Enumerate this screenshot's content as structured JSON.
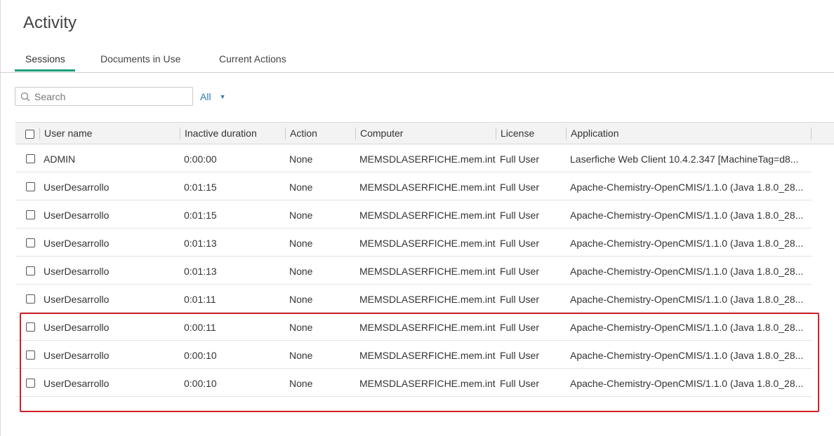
{
  "page": {
    "title": "Activity"
  },
  "tabs": [
    {
      "label": "Sessions",
      "active": true
    },
    {
      "label": "Documents in Use",
      "active": false
    },
    {
      "label": "Current Actions",
      "active": false
    }
  ],
  "search": {
    "placeholder": "Search",
    "value": ""
  },
  "filter": {
    "label": "All"
  },
  "grid": {
    "columns": [
      "User name",
      "Inactive duration",
      "Action",
      "Computer",
      "License",
      "Application"
    ],
    "rows": [
      {
        "user": "ADMIN",
        "inactive": "0:00:00",
        "action": "None",
        "computer": "MEMSDLASERFICHE.mem.int",
        "license": "Full User",
        "application": "Laserfiche Web Client 10.4.2.347 [MachineTag=d8..."
      },
      {
        "user": "UserDesarrollo",
        "inactive": "0:01:15",
        "action": "None",
        "computer": "MEMSDLASERFICHE.mem.int",
        "license": "Full User",
        "application": "Apache-Chemistry-OpenCMIS/1.1.0 (Java 1.8.0_28..."
      },
      {
        "user": "UserDesarrollo",
        "inactive": "0:01:15",
        "action": "None",
        "computer": "MEMSDLASERFICHE.mem.int",
        "license": "Full User",
        "application": "Apache-Chemistry-OpenCMIS/1.1.0 (Java 1.8.0_28..."
      },
      {
        "user": "UserDesarrollo",
        "inactive": "0:01:13",
        "action": "None",
        "computer": "MEMSDLASERFICHE.mem.int",
        "license": "Full User",
        "application": "Apache-Chemistry-OpenCMIS/1.1.0 (Java 1.8.0_28..."
      },
      {
        "user": "UserDesarrollo",
        "inactive": "0:01:13",
        "action": "None",
        "computer": "MEMSDLASERFICHE.mem.int",
        "license": "Full User",
        "application": "Apache-Chemistry-OpenCMIS/1.1.0 (Java 1.8.0_28..."
      },
      {
        "user": "UserDesarrollo",
        "inactive": "0:01:11",
        "action": "None",
        "computer": "MEMSDLASERFICHE.mem.int",
        "license": "Full User",
        "application": "Apache-Chemistry-OpenCMIS/1.1.0 (Java 1.8.0_28..."
      },
      {
        "user": "UserDesarrollo",
        "inactive": "0:00:11",
        "action": "None",
        "computer": "MEMSDLASERFICHE.mem.int",
        "license": "Full User",
        "application": "Apache-Chemistry-OpenCMIS/1.1.0 (Java 1.8.0_28..."
      },
      {
        "user": "UserDesarrollo",
        "inactive": "0:00:10",
        "action": "None",
        "computer": "MEMSDLASERFICHE.mem.int",
        "license": "Full User",
        "application": "Apache-Chemistry-OpenCMIS/1.1.0 (Java 1.8.0_28..."
      },
      {
        "user": "UserDesarrollo",
        "inactive": "0:00:10",
        "action": "None",
        "computer": "MEMSDLASERFICHE.mem.int",
        "license": "Full User",
        "application": "Apache-Chemistry-OpenCMIS/1.1.0 (Java 1.8.0_28..."
      }
    ]
  },
  "colors": {
    "accent": "#1a9e7a",
    "link": "#2b7bb9",
    "highlight": "#d3202a"
  }
}
